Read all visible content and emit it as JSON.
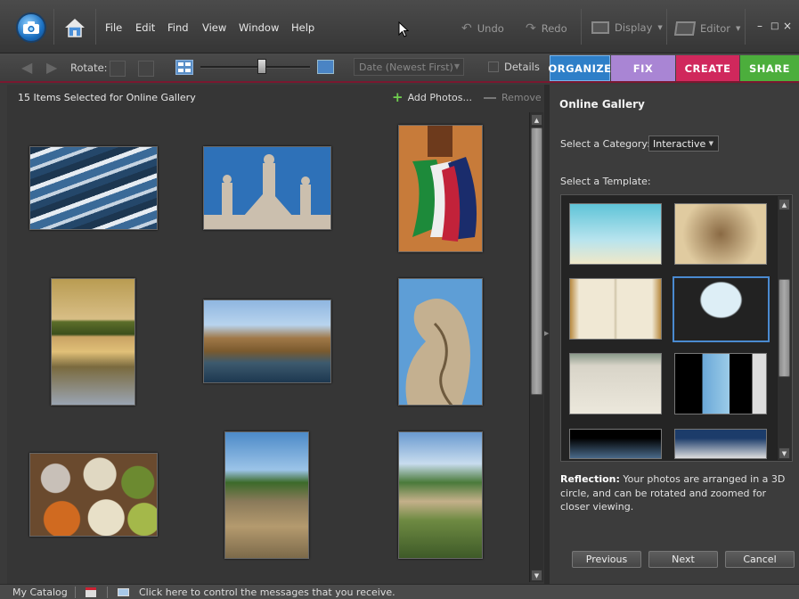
{
  "menubar": {
    "menus": [
      "File",
      "Edit",
      "Find",
      "View",
      "Window",
      "Help"
    ],
    "undo": "Undo",
    "redo": "Redo",
    "display": "Display",
    "editor": "Editor",
    "window_controls": {
      "minimize": "–",
      "restore": "□",
      "close": "×"
    }
  },
  "toolbar": {
    "rotate_label": "Rotate:",
    "sort_value": "Date (Newest First)",
    "details_label": "Details",
    "tabs": [
      {
        "label": "ORGANIZE",
        "color": "#2e7fc8"
      },
      {
        "label": "FIX",
        "color": "#b08ad8"
      },
      {
        "label": "CREATE",
        "color": "#d0285c"
      },
      {
        "label": "SHARE",
        "color": "#4cae3c"
      }
    ]
  },
  "left": {
    "title": "15 Items Selected for Online Gallery",
    "add_photos": "Add Photos...",
    "remove": "Remove",
    "photos": [
      "boats",
      "statues",
      "flags",
      "bridge",
      "castle",
      "angel-statue",
      "spices",
      "garden-wall",
      "park"
    ]
  },
  "right": {
    "title": "Online Gallery",
    "category_label": "Select a Category:",
    "category_value": "Interactive",
    "template_label": "Select a Template:",
    "desc_bold": "Reflection:",
    "desc_text": " Your photos are arranged in a 3D circle, and can be rotated and zoomed for closer viewing.",
    "buttons": {
      "previous": "Previous",
      "next": "Next",
      "cancel": "Cancel"
    }
  },
  "status": {
    "catalog": "My Catalog",
    "message": "Click here to control the messages that you receive."
  }
}
